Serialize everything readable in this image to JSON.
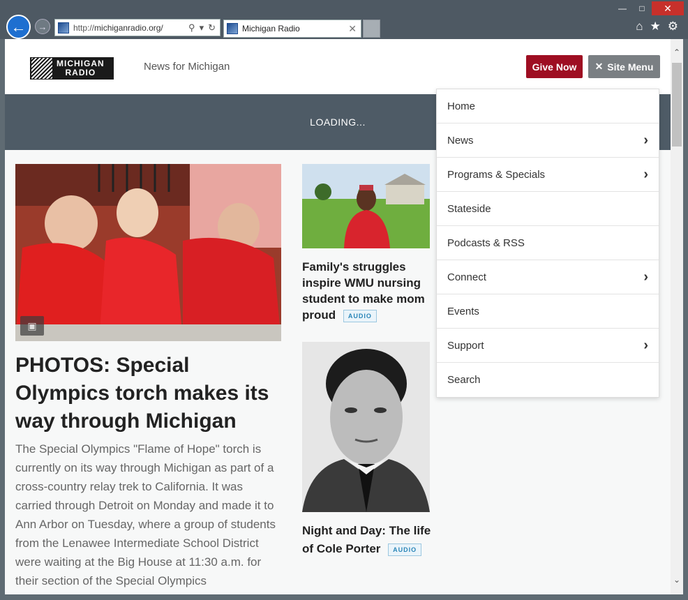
{
  "browser": {
    "url_prefix": "http://",
    "url_host": "michiganradio.org/",
    "tab_title": "Michigan Radio"
  },
  "header": {
    "logo_line1": "MICHIGAN",
    "logo_line2": "RADIO",
    "tagline": "News for Michigan",
    "give_label": "Give Now",
    "menu_label": "Site Menu"
  },
  "banner": {
    "loading_text": "LOADING..."
  },
  "lead": {
    "headline": "PHOTOS: Special Olympics torch makes its way through Michigan",
    "summary": "The Special Olympics \"Flame of Hope\" torch is currently on its way through Michigan as part of a cross-country relay trek to California. It was carried through Detroit on Monday and made it to Ann Arbor on Tuesday, where a group of students from the Lenawee Intermediate School District were waiting at the Big House at 11:30 a.m. for their section of the Special Olympics"
  },
  "stories": [
    {
      "headline": "Family's struggles inspire WMU nursing student to make mom proud",
      "badge": "AUDIO"
    },
    {
      "headline": "Night and Day: The life of Cole Porter",
      "badge": "AUDIO"
    }
  ],
  "menu": {
    "items": [
      {
        "label": "Home"
      },
      {
        "label": "News"
      },
      {
        "label": "Programs & Specials"
      },
      {
        "label": "Stateside"
      },
      {
        "label": "Podcasts & RSS"
      },
      {
        "label": "Connect"
      },
      {
        "label": "Events"
      },
      {
        "label": "Support"
      },
      {
        "label": "Search"
      }
    ]
  },
  "colors": {
    "give_button": "#9e0e22",
    "menu_button": "#7a7f83",
    "banner": "#4e5b66",
    "badge_text": "#2a86b8"
  }
}
